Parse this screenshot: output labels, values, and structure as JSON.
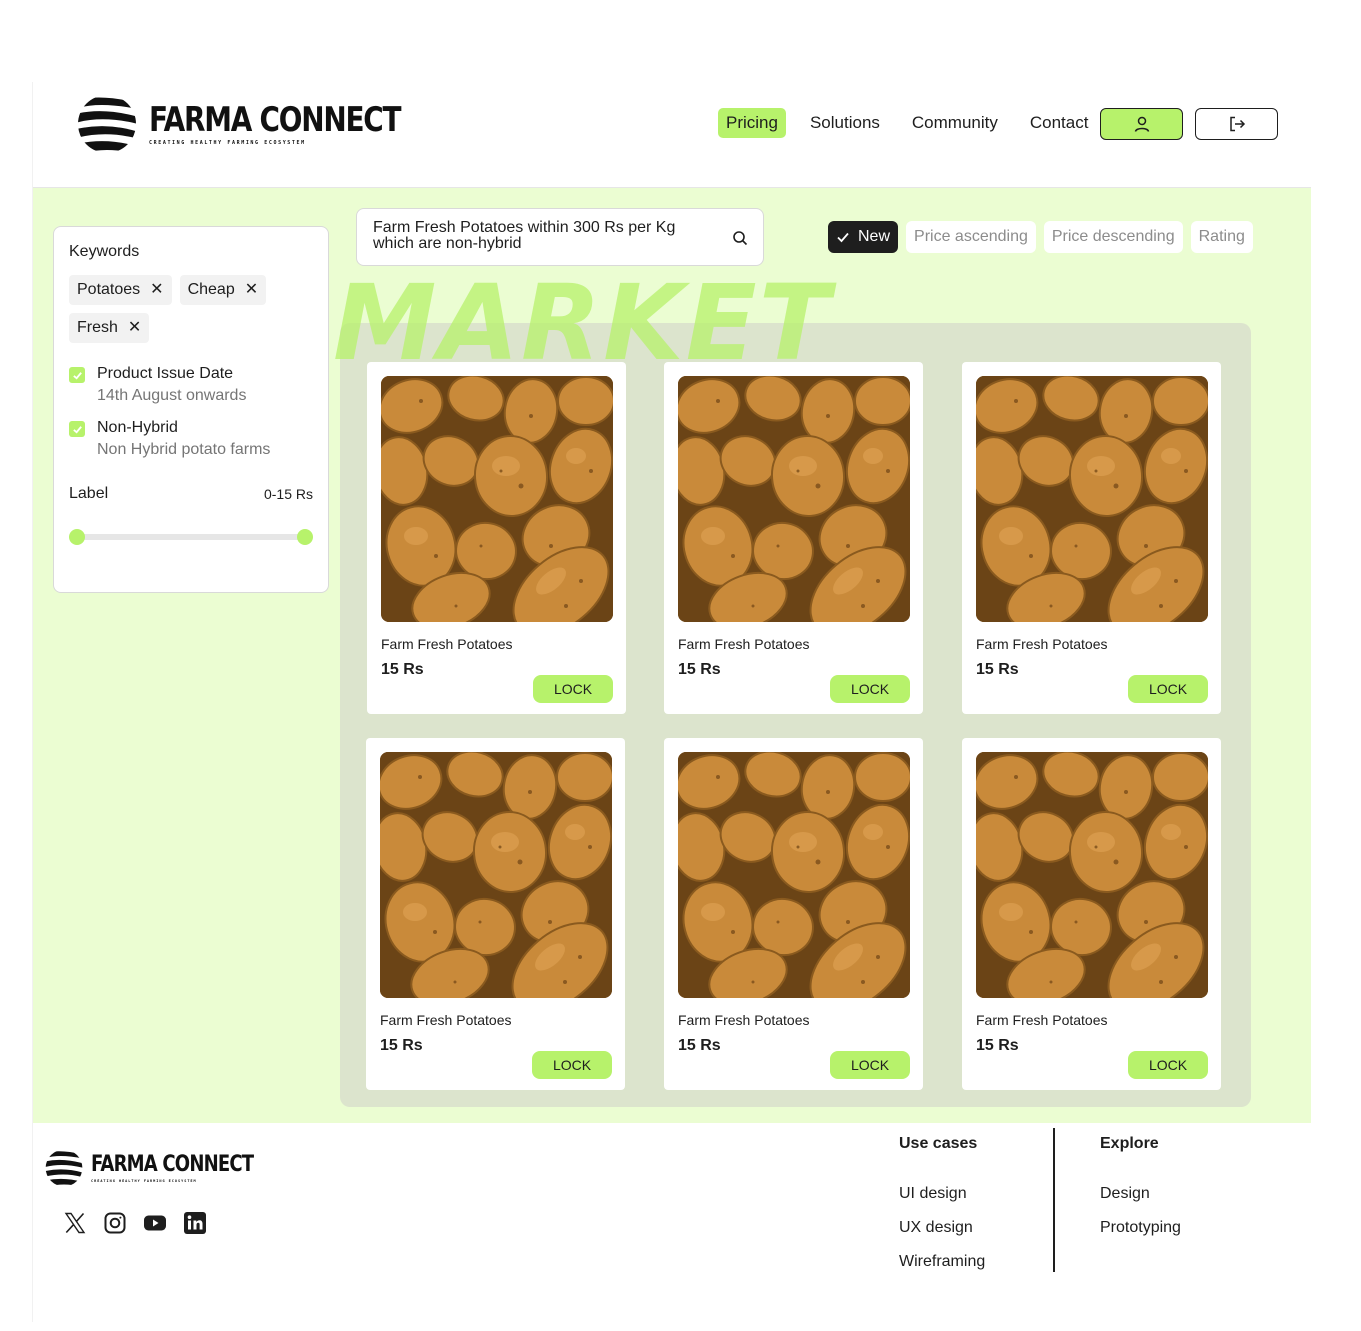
{
  "brand": {
    "name": "FARMA CONNECT",
    "tagline": "CREATING HEALTHY FARMING ECOSYSTEM"
  },
  "nav": {
    "items": [
      {
        "label": "Pricing",
        "active": true
      },
      {
        "label": "Solutions"
      },
      {
        "label": "Community"
      },
      {
        "label": "Contact"
      }
    ],
    "user_icon": "user-icon",
    "logout_icon": "logout-icon"
  },
  "filters": {
    "keywords_title": "Keywords",
    "tags": [
      "Potatoes",
      "Cheap",
      "Fresh"
    ],
    "checks": [
      {
        "label": "Product Issue Date",
        "desc": "14th August onwards",
        "checked": true
      },
      {
        "label": "Non-Hybrid",
        "desc": "Non Hybrid potato farms",
        "checked": true
      }
    ],
    "range_label": "Label",
    "range_value": "0-15 Rs"
  },
  "search": {
    "query": "Farm Fresh Potatoes within 300 Rs per Kg which are non-hybrid",
    "icon": "search-icon"
  },
  "sort": {
    "options": [
      "New",
      "Price ascending",
      "Price descending",
      "Rating"
    ],
    "selected": "New"
  },
  "market_heading": "MARKET",
  "products": [
    {
      "name": "Farm Fresh Potatoes",
      "price": "15 Rs",
      "action": "LOCK"
    },
    {
      "name": "Farm Fresh Potatoes",
      "price": "15 Rs",
      "action": "LOCK"
    },
    {
      "name": "Farm Fresh Potatoes",
      "price": "15 Rs",
      "action": "LOCK"
    },
    {
      "name": "Farm Fresh Potatoes",
      "price": "15 Rs",
      "action": "LOCK"
    },
    {
      "name": "Farm Fresh Potatoes",
      "price": "15 Rs",
      "action": "LOCK"
    },
    {
      "name": "Farm Fresh Potatoes",
      "price": "15 Rs",
      "action": "LOCK"
    }
  ],
  "footer": {
    "socials": [
      "x-icon",
      "instagram-icon",
      "youtube-icon",
      "linkedin-icon"
    ],
    "columns": [
      {
        "title": "Use cases",
        "links": [
          "UI design",
          "UX design",
          "Wireframing"
        ]
      },
      {
        "title": "Explore",
        "links": [
          "Design",
          "Prototyping"
        ]
      }
    ]
  },
  "colors": {
    "accent": "#b7f26b",
    "background": "#ebfdd2",
    "panel": "#dce4cd",
    "dark": "#1e1e1e"
  }
}
